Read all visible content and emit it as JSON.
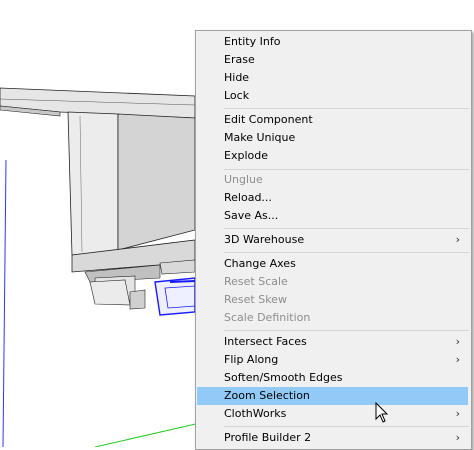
{
  "menu": {
    "items": [
      {
        "label": "Entity Info",
        "enabled": true,
        "submenu": false
      },
      {
        "label": "Erase",
        "enabled": true,
        "submenu": false
      },
      {
        "label": "Hide",
        "enabled": true,
        "submenu": false
      },
      {
        "label": "Lock",
        "enabled": true,
        "submenu": false
      },
      {
        "label": "Edit Component",
        "enabled": true,
        "submenu": false
      },
      {
        "label": "Make Unique",
        "enabled": true,
        "submenu": false
      },
      {
        "label": "Explode",
        "enabled": true,
        "submenu": false
      },
      {
        "label": "Unglue",
        "enabled": false,
        "submenu": false
      },
      {
        "label": "Reload...",
        "enabled": true,
        "submenu": false
      },
      {
        "label": "Save As...",
        "enabled": true,
        "submenu": false
      },
      {
        "label": "3D Warehouse",
        "enabled": true,
        "submenu": true
      },
      {
        "label": "Change Axes",
        "enabled": true,
        "submenu": false
      },
      {
        "label": "Reset Scale",
        "enabled": false,
        "submenu": false
      },
      {
        "label": "Reset Skew",
        "enabled": false,
        "submenu": false
      },
      {
        "label": "Scale Definition",
        "enabled": false,
        "submenu": false
      },
      {
        "label": "Intersect Faces",
        "enabled": true,
        "submenu": true
      },
      {
        "label": "Flip Along",
        "enabled": true,
        "submenu": true
      },
      {
        "label": "Soften/Smooth Edges",
        "enabled": true,
        "submenu": false
      },
      {
        "label": "Zoom Selection",
        "enabled": true,
        "submenu": false,
        "highlighted": true
      },
      {
        "label": "ClothWorks",
        "enabled": true,
        "submenu": true
      },
      {
        "label": "Profile Builder 2",
        "enabled": true,
        "submenu": true
      }
    ],
    "submenu_arrow": "›"
  },
  "colors": {
    "highlight": "#91c9f7",
    "disabled_text": "#8d8d8d",
    "selection_blue": "#1a1aff",
    "axis_green": "#22cc22"
  },
  "icons": {
    "cursor": "mouse-pointer-icon",
    "submenu": "chevron-right-icon"
  }
}
